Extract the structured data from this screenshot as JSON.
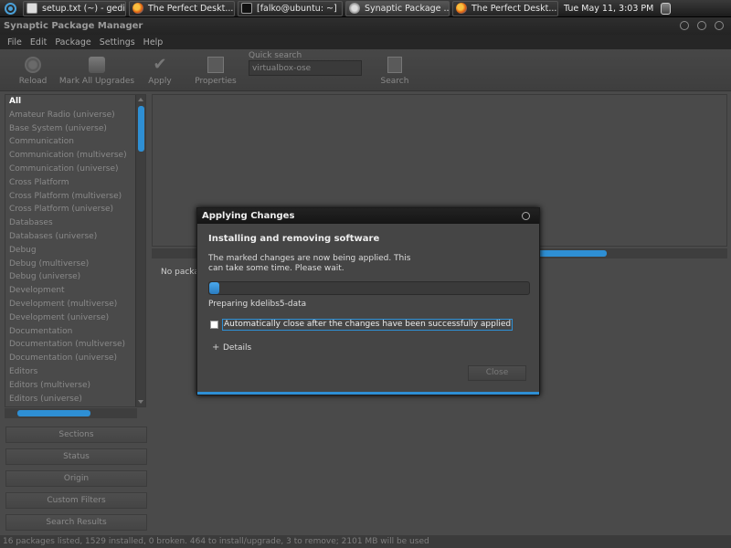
{
  "taskbar": {
    "tasks": [
      {
        "label": "setup.txt (~) - gedit",
        "icon": "gedit-icon"
      },
      {
        "label": "The Perfect Deskt...",
        "icon": "firefox-icon"
      },
      {
        "label": "[falko@ubuntu: ~]",
        "icon": "terminal-icon"
      },
      {
        "label": "Synaptic Package ...",
        "icon": "synaptic-icon"
      },
      {
        "label": "The Perfect Deskt...",
        "icon": "firefox-icon"
      }
    ],
    "clock": "Tue May 11,  3:03 PM"
  },
  "window": {
    "title": "Synaptic Package Manager"
  },
  "menu": {
    "items": [
      "File",
      "Edit",
      "Package",
      "Settings",
      "Help"
    ]
  },
  "toolbar": {
    "reload": "Reload",
    "mark_all": "Mark All Upgrades",
    "apply": "Apply",
    "properties": "Properties",
    "quick_search_label": "Quick search",
    "quick_search_value": "virtualbox-ose",
    "search": "Search"
  },
  "categories": [
    "All",
    "Amateur Radio (universe)",
    "Base System (universe)",
    "Communication",
    "Communication (multiverse)",
    "Communication (universe)",
    "Cross Platform",
    "Cross Platform (multiverse)",
    "Cross Platform (universe)",
    "Databases",
    "Databases (universe)",
    "Debug",
    "Debug (multiverse)",
    "Debug (universe)",
    "Development",
    "Development (multiverse)",
    "Development (universe)",
    "Documentation",
    "Documentation (multiverse)",
    "Documentation (universe)",
    "Editors",
    "Editors (multiverse)",
    "Editors (universe)"
  ],
  "side_buttons": {
    "sections": "Sections",
    "status": "Status",
    "origin": "Origin",
    "custom_filters": "Custom Filters",
    "search_results": "Search Results"
  },
  "main": {
    "desc_text": "No packa"
  },
  "statusbar": {
    "text": "16 packages listed, 1529 installed, 0 broken. 464 to install/upgrade, 3 to remove; 2101 MB will be used"
  },
  "dialog": {
    "title": "Applying Changes",
    "heading": "Installing and removing software",
    "body": "The marked changes are now being applied. This can take some time. Please wait.",
    "progress": 0.02,
    "status": "Preparing kdelibs5-data",
    "autoclose_label": "Automatically close after the changes have been successfully applied",
    "details_label": "Details",
    "close_button": "Close"
  },
  "colors": {
    "accent": "#2e8fd4",
    "background": "#4a4a4a"
  }
}
